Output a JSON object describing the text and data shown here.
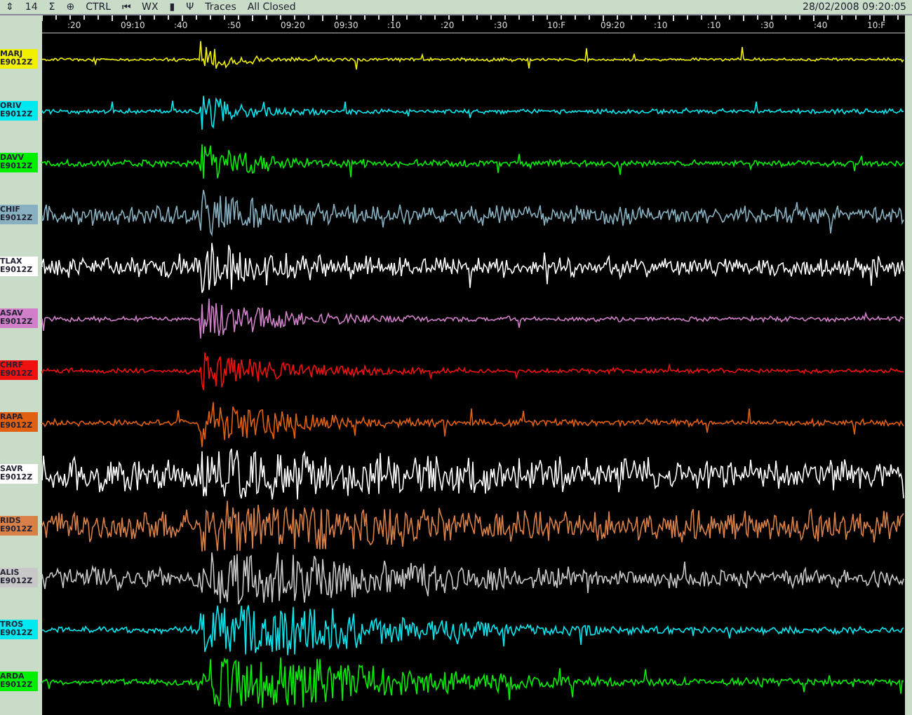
{
  "toolbar": {
    "items": [
      "⇕",
      "14",
      "Σ",
      "⊕",
      "CTRL",
      "⏮",
      "WX",
      "▮",
      "Ψ",
      "Traces",
      "All Closed"
    ],
    "datetime": "28/02/2008 09:20:05"
  },
  "time_axis": {
    "labels": [
      ":20",
      "09:10",
      ":40",
      ":50",
      "09:20",
      "09:30",
      ":10",
      ":20",
      ":30",
      "10:F",
      "09:20",
      ":10",
      ":10",
      ":30",
      ":40",
      "10:F"
    ]
  },
  "channels": [
    {
      "name": "MARJ",
      "code": "E9012Z",
      "color": "#f0f000"
    },
    {
      "name": "ORIV",
      "code": "E9012Z",
      "color": "#00e8f0"
    },
    {
      "name": "DAVV",
      "code": "E9012Z",
      "color": "#00f000"
    },
    {
      "name": "CHIF",
      "code": "E9012Z",
      "color": "#88b0c0"
    },
    {
      "name": "TLAX",
      "code": "E9012Z",
      "color": "#ffffff"
    },
    {
      "name": "ASAV",
      "code": "E9012Z",
      "color": "#d080c8"
    },
    {
      "name": "CHRF",
      "code": "E9012Z",
      "color": "#f01010"
    },
    {
      "name": "RAPA",
      "code": "E9012Z",
      "color": "#e06010"
    },
    {
      "name": "SAVR",
      "code": "E9012Z",
      "color": "#ffffff"
    },
    {
      "name": "RIDS",
      "code": "E9012Z",
      "color": "#d88048"
    },
    {
      "name": "ALIS",
      "code": "E9012Z",
      "color": "#c8c8c8"
    },
    {
      "name": "TROS",
      "code": "E9012Z",
      "color": "#00e8f0"
    },
    {
      "name": "ARDA",
      "code": "E9012Z",
      "color": "#00f000"
    }
  ]
}
